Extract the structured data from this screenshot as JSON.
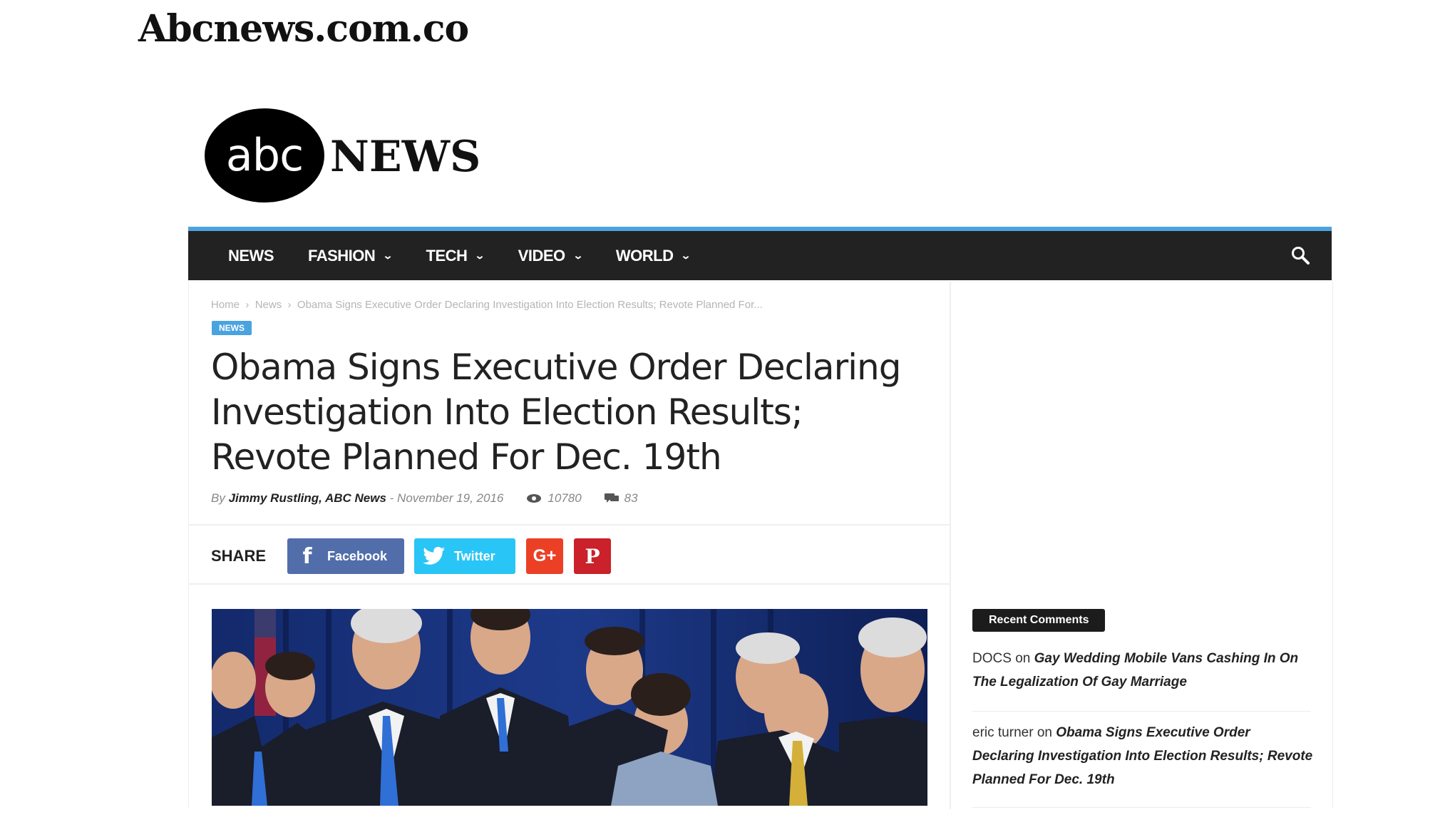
{
  "caption": "Abcnews.com.co",
  "logo": {
    "oval_text": "abc",
    "word": "NEWS"
  },
  "nav": {
    "items": [
      {
        "label": "NEWS",
        "has_dropdown": false
      },
      {
        "label": "FASHION",
        "has_dropdown": true
      },
      {
        "label": "TECH",
        "has_dropdown": true
      },
      {
        "label": "VIDEO",
        "has_dropdown": true
      },
      {
        "label": "WORLD",
        "has_dropdown": true
      }
    ],
    "search_icon": "search-icon",
    "accent_color": "#4aa3df",
    "bar_color": "#222222"
  },
  "breadcrumb": {
    "home": "Home",
    "section": "News",
    "current": "Obama Signs Executive Order Declaring Investigation Into Election Results; Revote Planned For..."
  },
  "article": {
    "category_badge": "NEWS",
    "headline": "Obama Signs Executive Order Declaring Investigation Into Election Results; Revote Planned For Dec. 19th",
    "by": "By",
    "author": "Jimmy Rustling, ABC News",
    "date": "- November 19, 2016",
    "views": "10780",
    "comments": "83"
  },
  "share": {
    "label": "SHARE",
    "facebook": "Facebook",
    "twitter": "Twitter",
    "google_plus": "G+",
    "pinterest": "P"
  },
  "sidebar": {
    "recent_comments_title": "Recent Comments",
    "comments": [
      {
        "author": "DOCS",
        "on": "on",
        "post": "Gay Wedding Mobile Vans Cashing In On The Legalization Of Gay Marriage"
      },
      {
        "author": "eric turner",
        "on": "on",
        "post": "Obama Signs Executive Order Declaring Investigation Into Election Results; Revote Planned For Dec. 19th"
      }
    ]
  }
}
